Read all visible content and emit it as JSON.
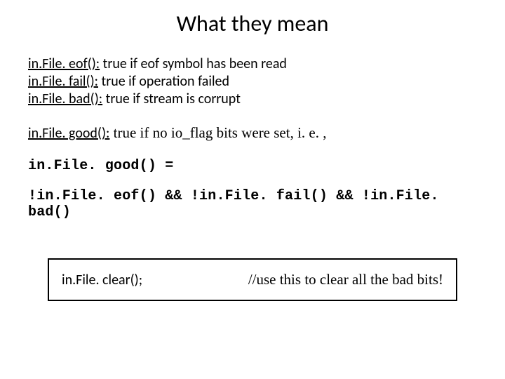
{
  "title": "What they mean",
  "defs": {
    "eof": {
      "name": "in.File. eof():",
      "desc": "  true if eof symbol has been read"
    },
    "fail": {
      "name": "in.File. fail():",
      "desc": "  true if operation failed"
    },
    "bad": {
      "name": "in.File. bad():",
      "desc": "  true if stream is corrupt"
    },
    "good": {
      "name": "in.File. good():",
      "desc": "  true if no io_flag bits were set, i. e. ,"
    }
  },
  "code": {
    "lhs": "in.File. good() =",
    "expr": "!in.File. eof() && !in.File. fail() && !in.File. bad()"
  },
  "box": {
    "left": "in.File. clear();",
    "right": "//use this to clear all the bad bits!"
  }
}
